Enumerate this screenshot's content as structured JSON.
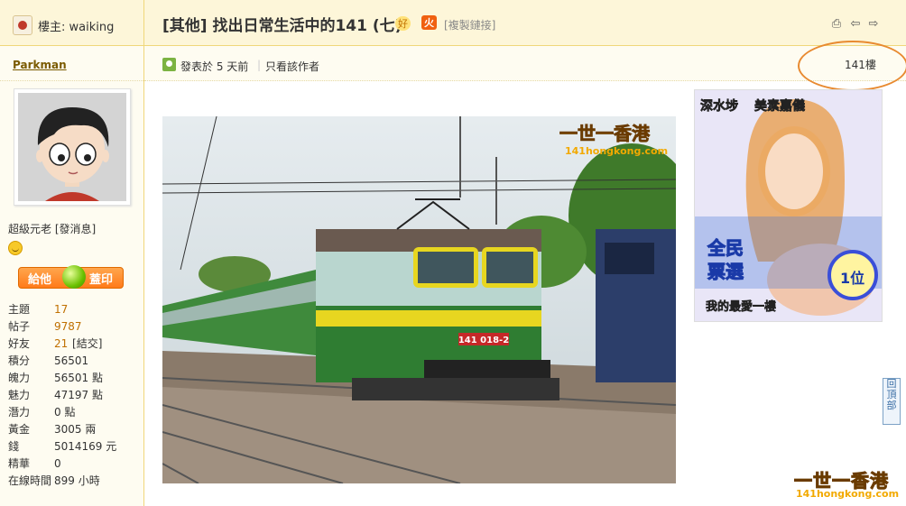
{
  "header": {
    "owner_label": "樓主: waiking",
    "title": "[其他] 找出日常生活中的141 (七)",
    "badge_good": "好",
    "badge_fire": "火",
    "copy_link": "[複製鏈接]"
  },
  "post_meta": {
    "posted": "發表於 5 天前",
    "only_author": "只看該作者",
    "floor": "141樓"
  },
  "user": {
    "name": "Parkman",
    "rank": "超級元老",
    "send_msg": "發消息",
    "give_btn_left": "給他",
    "give_btn_right": "蓋印"
  },
  "stats": [
    {
      "key": "主題",
      "value": "17",
      "highlight": true
    },
    {
      "key": "帖子",
      "value": "9787",
      "highlight": true
    },
    {
      "key": "好友",
      "value": "21",
      "highlight": true,
      "extra": "結交"
    },
    {
      "key": "積分",
      "value": "56501"
    },
    {
      "key": "魄力",
      "value": "56501 點"
    },
    {
      "key": "魅力",
      "value": "47197 點"
    },
    {
      "key": "潛力",
      "value": "0 點"
    },
    {
      "key": "黃金",
      "value": "3005 兩"
    },
    {
      "key": "錢",
      "value": "5014169 元"
    },
    {
      "key": "精華",
      "value": "0"
    },
    {
      "key": "在線時間",
      "value": "899 小時"
    }
  ],
  "photo": {
    "watermark_cn": "一世一香港",
    "watermark_url": "141hongkong.com",
    "locomotive_number": "141 018-2"
  },
  "ad": {
    "top_left": "深水埗",
    "top_right": "美素嘉儀",
    "line1": "全民",
    "line2": "票選",
    "rank": "1位",
    "bottom": "我的最愛一樓"
  },
  "back_to_top": "回頂部",
  "corner_watermark": {
    "cn": "一世一香港",
    "url": "141hongkong.com"
  },
  "colors": {
    "accent": "#f0d77a",
    "link": "#7a5a00",
    "highlight": "#c07000",
    "annotation_circle": "#e88a30"
  }
}
